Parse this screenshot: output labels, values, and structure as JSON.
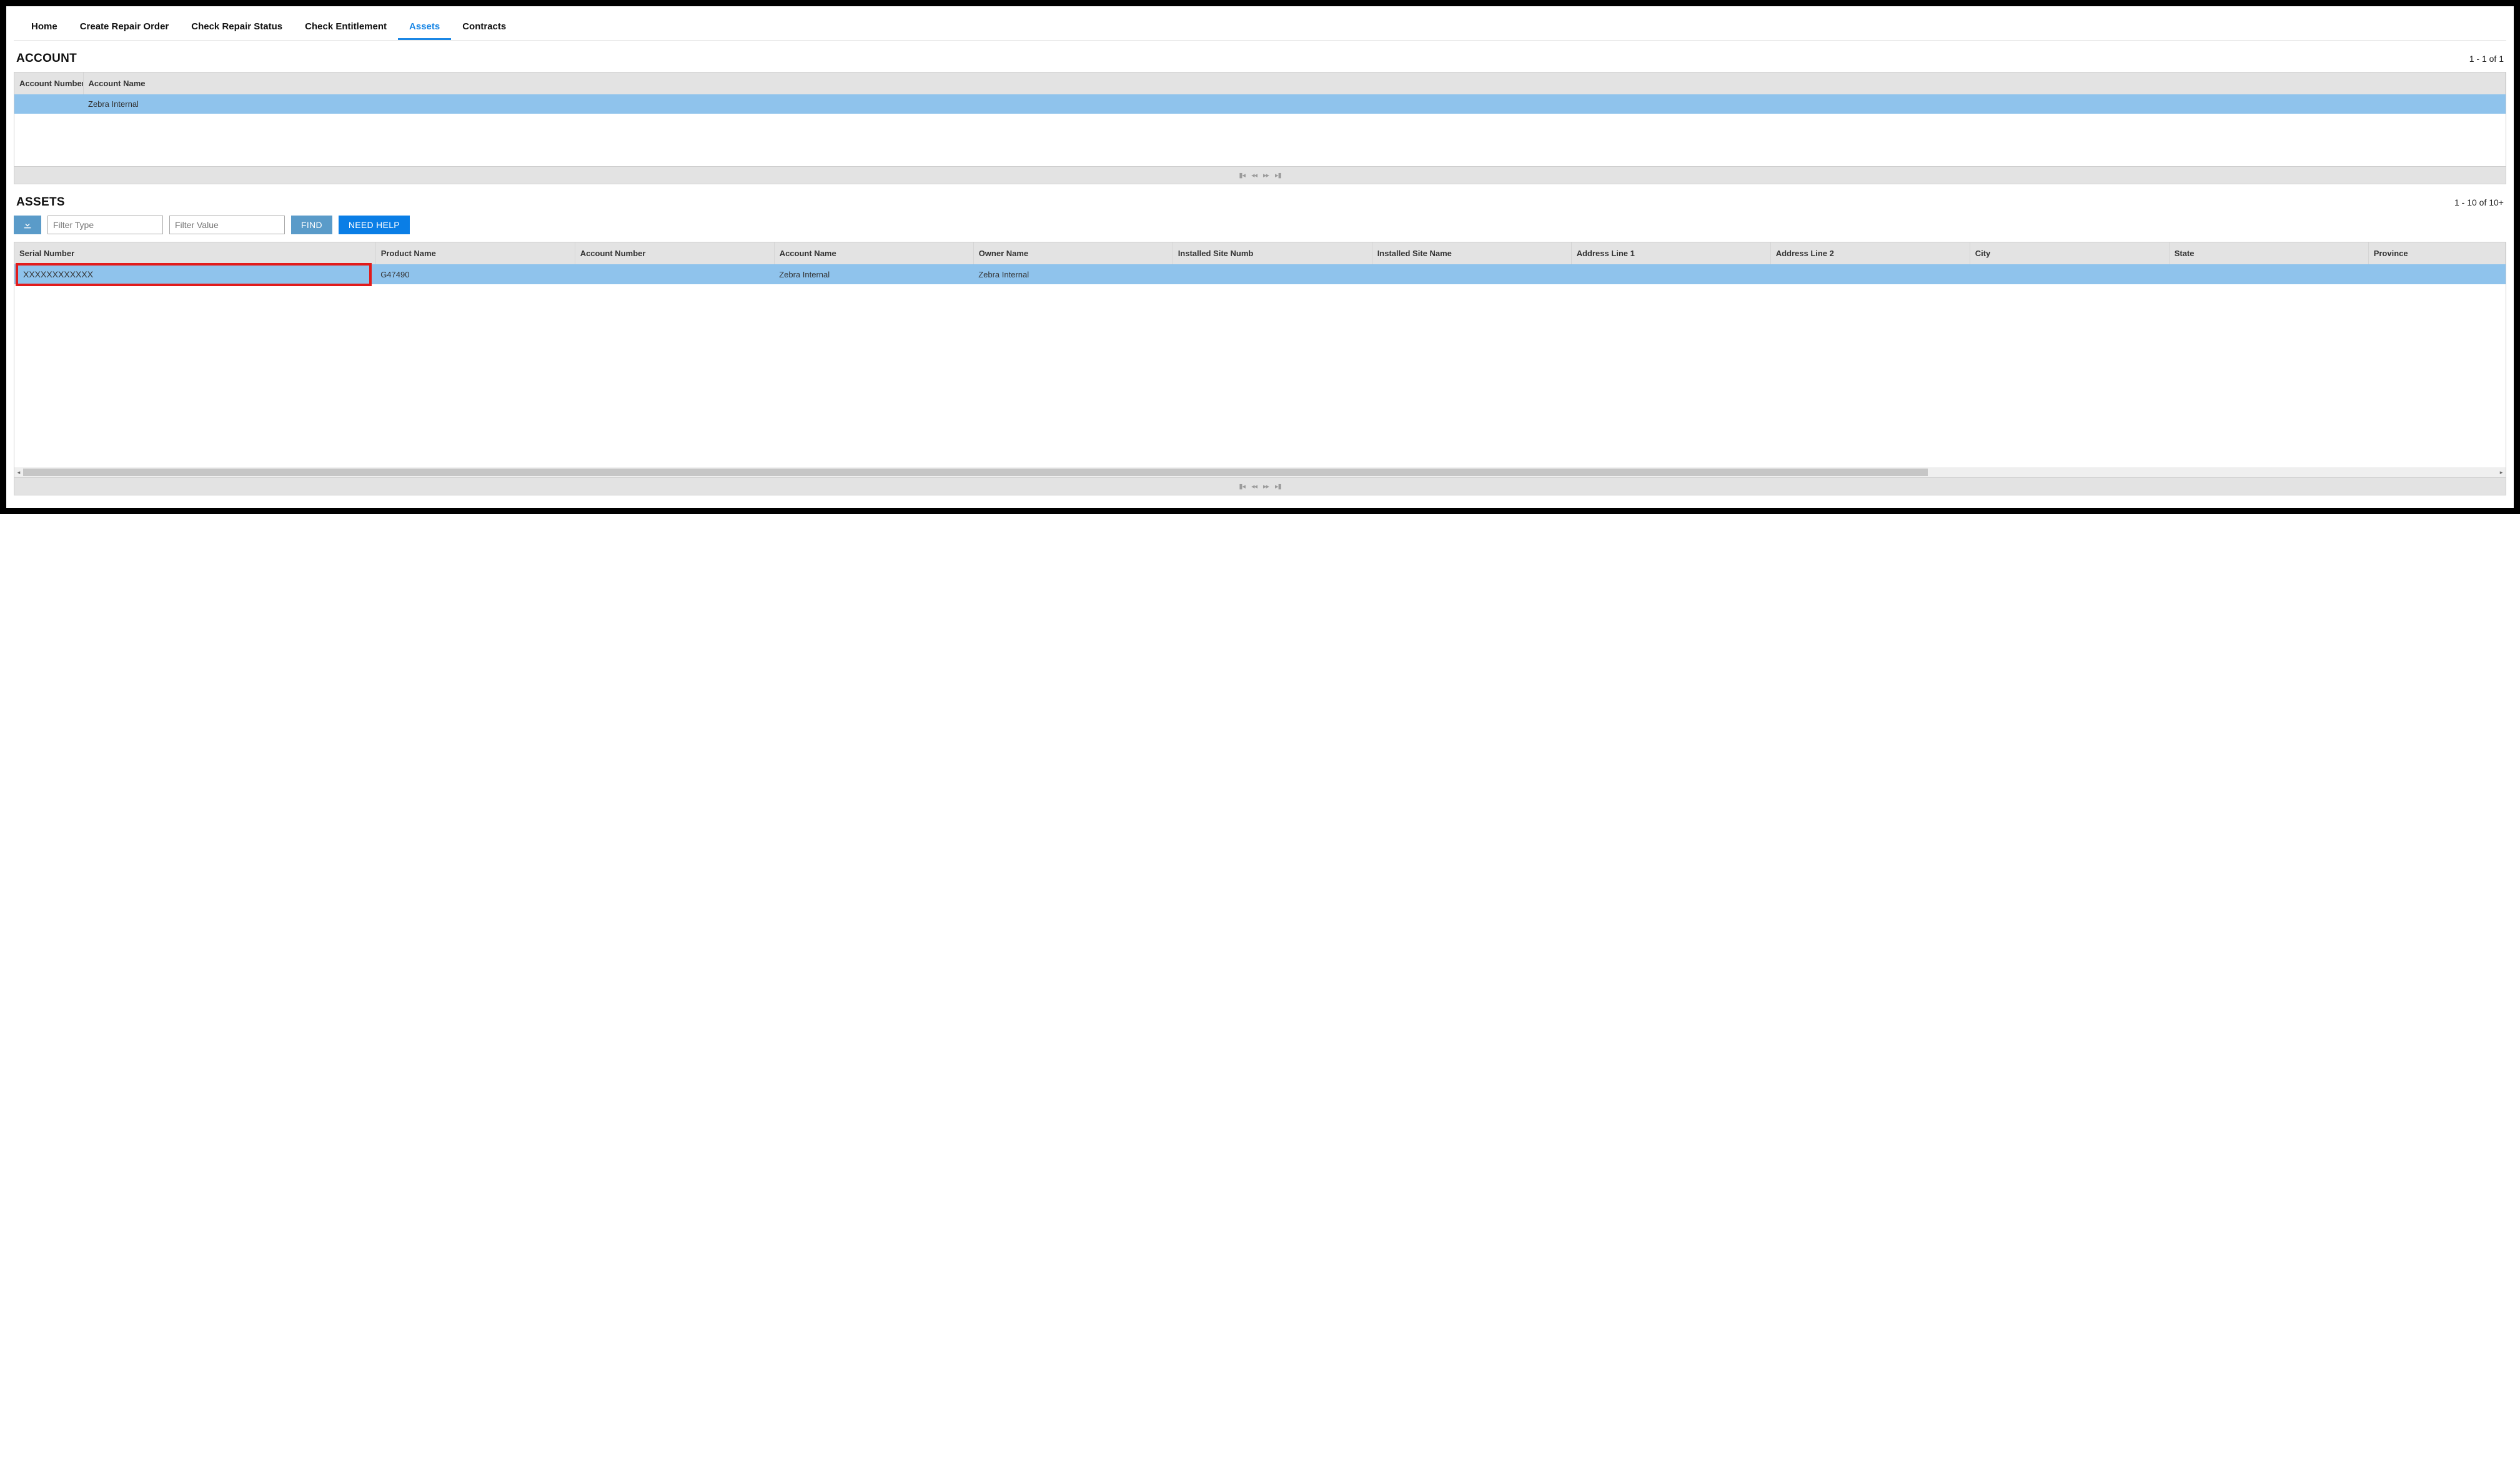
{
  "nav": {
    "tabs": [
      {
        "label": "Home",
        "active": false
      },
      {
        "label": "Create Repair Order",
        "active": false
      },
      {
        "label": "Check Repair Status",
        "active": false
      },
      {
        "label": "Check Entitlement",
        "active": false
      },
      {
        "label": "Assets",
        "active": true
      },
      {
        "label": "Contracts",
        "active": false
      }
    ]
  },
  "account_section": {
    "title": "ACCOUNT",
    "count_text": "1 - 1 of 1",
    "columns": [
      "Account Number",
      "Account Name"
    ],
    "rows": [
      {
        "account_number": "",
        "account_name": "Zebra Internal",
        "selected": true
      }
    ]
  },
  "assets_section": {
    "title": "ASSETS",
    "count_text": "1 - 10 of 10+",
    "filter_type_placeholder": "Filter Type",
    "filter_value_placeholder": "Filter Value",
    "find_label": "FIND",
    "help_label": "NEED HELP",
    "columns": [
      "Serial Number",
      "Product Name",
      "Account Number",
      "Account Name",
      "Owner Name",
      "Installed Site Numb",
      "Installed Site Name",
      "Address Line 1",
      "Address Line 2",
      "City",
      "State",
      "Province"
    ],
    "rows": [
      {
        "serial_number": "XXXXXXXXXXXX",
        "product_name": "G47490",
        "account_number": "",
        "account_name": "Zebra Internal",
        "owner_name": "Zebra Internal",
        "installed_site_numb": "",
        "installed_site_name": "",
        "address_line_1": "",
        "address_line_2": "",
        "city": "",
        "state": "",
        "province": "",
        "selected": true
      }
    ]
  },
  "colors": {
    "accent": "#1b87e5",
    "row_selected": "#8fc3ec",
    "header_bg": "#e3e3e3",
    "btn_primary": "#0a7ee6",
    "btn_secondary": "#5a9bc9",
    "highlight": "#e21b1b"
  }
}
